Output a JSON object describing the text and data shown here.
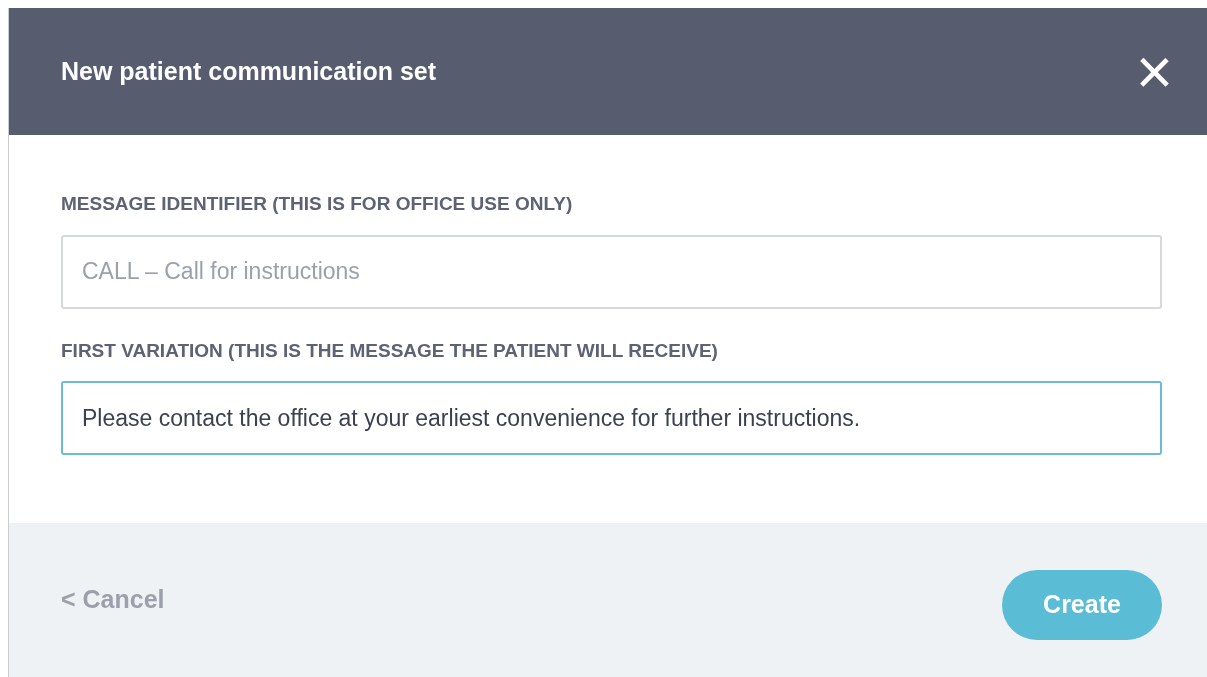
{
  "dialog": {
    "title": "New patient communication set",
    "close": "×"
  },
  "fields": [
    {
      "label": "MESSAGE IDENTIFIER (THIS IS FOR OFFICE USE ONLY)",
      "placeholder": "CALL – Call for instructions",
      "focused": false
    },
    {
      "label": "FIRST VARIATION (THIS IS THE MESSAGE THE PATIENT WILL RECEIVE)",
      "value": "Please contact the office at your earliest convenience for further instructions.",
      "focused": true
    }
  ],
  "footer": {
    "cancel": "< Cancel",
    "create": "Create"
  }
}
